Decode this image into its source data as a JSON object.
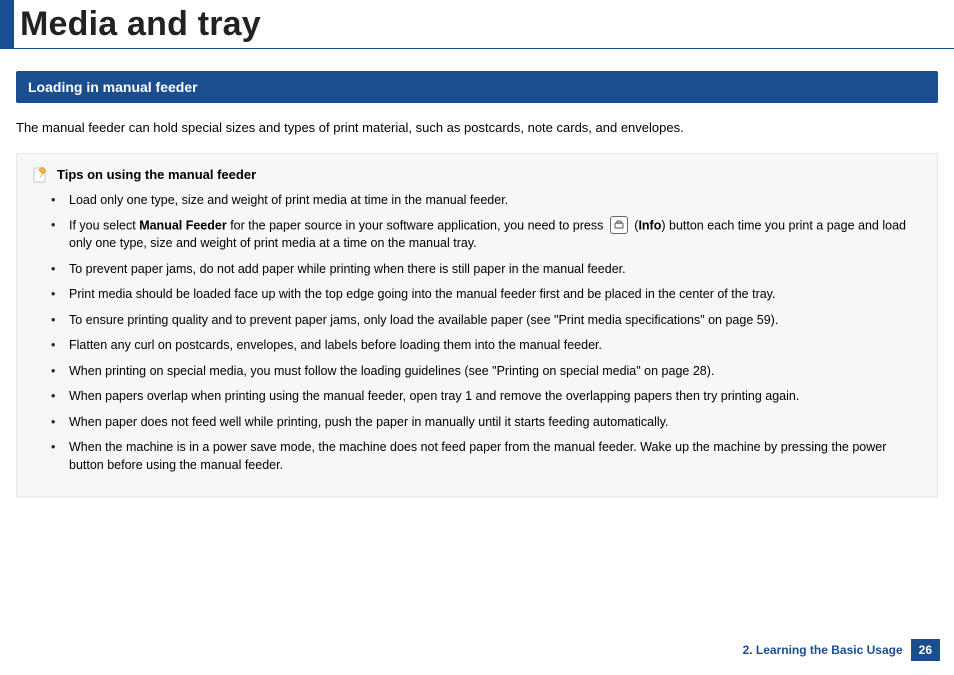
{
  "header": {
    "title": "Media and tray"
  },
  "section": {
    "heading": "Loading in manual feeder"
  },
  "intro": "The manual feeder can hold special sizes and types of print material, such as postcards, note cards, and envelopes.",
  "tips": {
    "title": "Tips on using the manual feeder",
    "items": {
      "t0": "Load only one type, size and weight of print media at time in the manual feeder.",
      "t1a": "If you select ",
      "t1b": "Manual Feeder",
      "t1c": " for the paper source in your software application, you need to press ",
      "t1d": " (",
      "t1e": "Info",
      "t1f": ") button each time you print a page and load only one type, size and weight of print media at a time on the manual tray.",
      "t2": "To prevent paper jams, do not add paper while printing when there is still paper in the manual feeder.",
      "t3": "Print media should be loaded face up with the top edge going into the manual feeder first and be placed in the center of the tray.",
      "t4": "To ensure printing quality and to prevent paper jams, only load the available paper (see \"Print media specifications\" on page 59).",
      "t5": "Flatten any curl on postcards, envelopes, and labels before loading them into the manual feeder.",
      "t6": "When printing on special media, you must follow the loading guidelines (see \"Printing on special media\" on page 28).",
      "t7": "When papers overlap when printing using the manual feeder, open tray 1 and remove the overlapping papers then try printing again.",
      "t8": "When paper does not feed well while printing, push the paper in manually until it starts feeding automatically.",
      "t9": "When the machine is in a power save mode, the machine does not feed paper from the manual feeder. Wake up the machine by pressing the power button before using the manual feeder."
    }
  },
  "footer": {
    "chapter": "2. Learning the Basic Usage",
    "page": "26"
  }
}
